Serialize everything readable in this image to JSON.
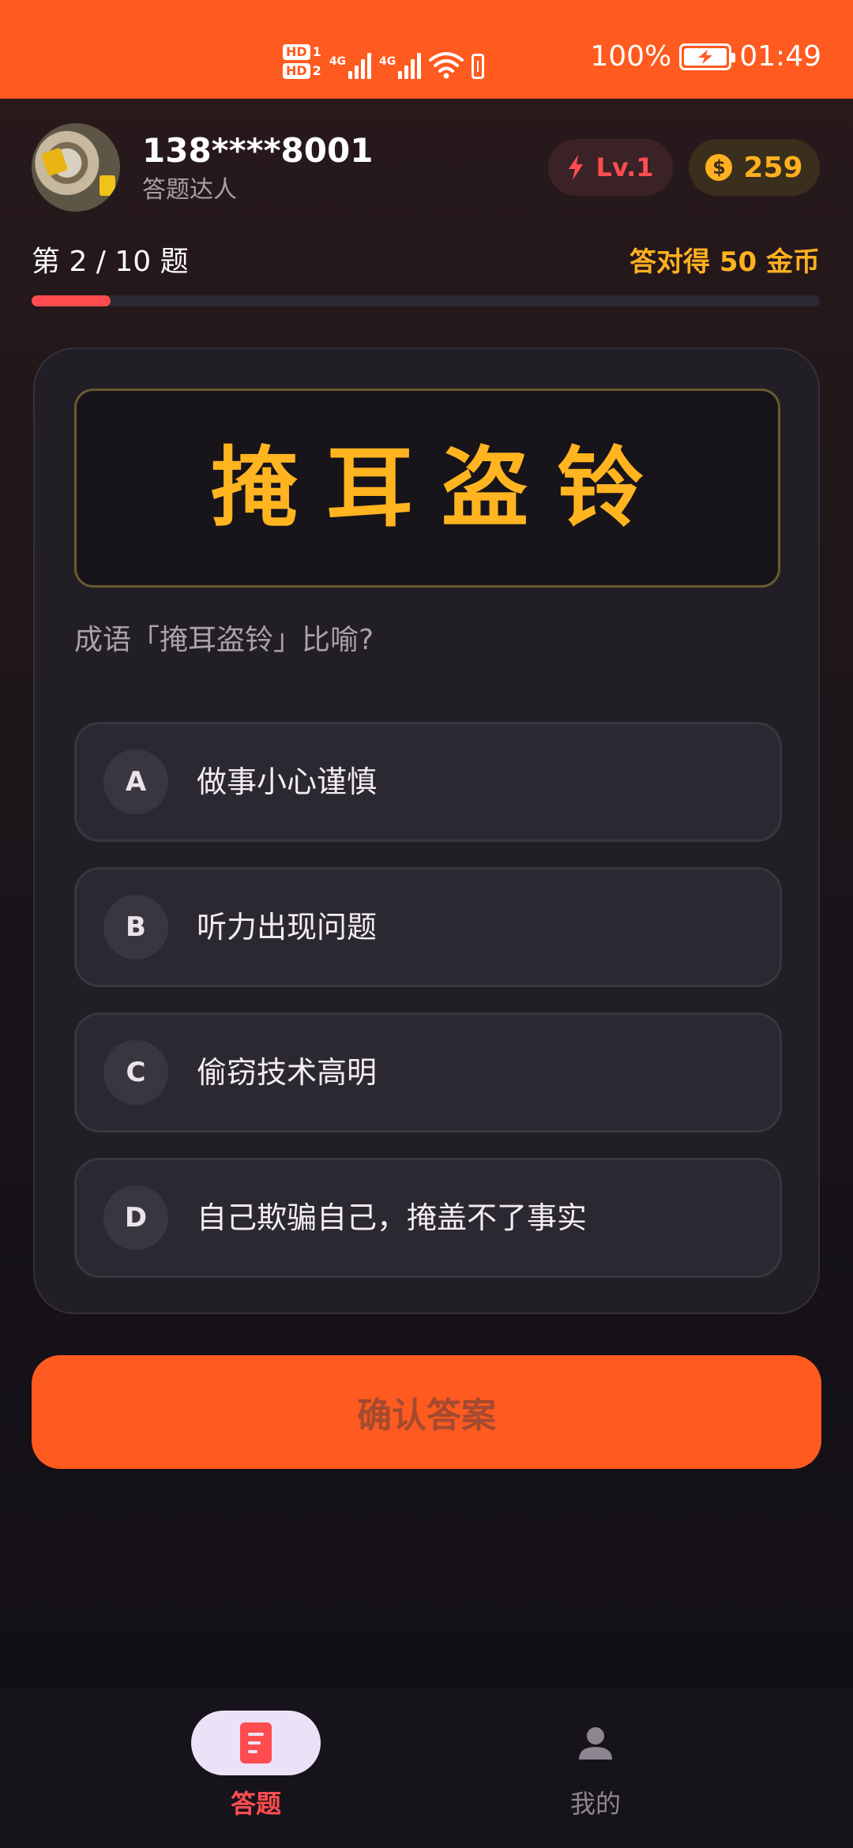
{
  "status_bar": {
    "battery_percent": "100%",
    "time": "01:49",
    "hd1": "HD",
    "hd1_num": "1",
    "hd2": "HD",
    "hd2_num": "2",
    "net1": "4G",
    "net2": "4G",
    "icons": [
      "signal-icon",
      "wifi-icon",
      "battery-icon",
      "charging-icon"
    ]
  },
  "user": {
    "phone": "138****8001",
    "title": "答题达人",
    "level": "Lv.1",
    "coins": "259",
    "coin_symbol": "$"
  },
  "quiz": {
    "progress_label": "第 2 / 10 题",
    "reward_label": "答对得 50 金币",
    "progress_fraction": 0.1,
    "idiom": "掩耳盗铃",
    "prompt": "成语「掩耳盗铃」比喻?",
    "options": [
      {
        "letter": "A",
        "text": "做事小心谨慎"
      },
      {
        "letter": "B",
        "text": "听力出现问题"
      },
      {
        "letter": "C",
        "text": "偷窃技术高明"
      },
      {
        "letter": "D",
        "text": "自己欺骗自己，掩盖不了事实"
      }
    ],
    "confirm_label": "确认答案"
  },
  "nav": {
    "items": [
      {
        "label": "答题",
        "icon": "quiz-icon",
        "active": true
      },
      {
        "label": "我的",
        "icon": "profile-icon",
        "active": false
      }
    ]
  },
  "colors": {
    "accent": "#ff5a1f",
    "danger": "#ff4d4f",
    "gold": "#ffb020"
  }
}
